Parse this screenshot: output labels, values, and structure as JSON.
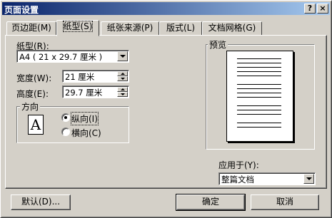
{
  "window": {
    "title": "页面设置",
    "help_label": "?",
    "close_label": "×"
  },
  "tabs": [
    {
      "label": "页边距(M)"
    },
    {
      "label": "纸型(S)"
    },
    {
      "label": "纸张来源(P)"
    },
    {
      "label": "版式(L)"
    },
    {
      "label": "文档网格(G)"
    }
  ],
  "paper": {
    "size_label": "纸型(R):",
    "size_value": "A4 ( 21 x 29.7 厘米 )",
    "width_label": "宽度(W):",
    "width_value": "21 厘米",
    "height_label": "高度(E):",
    "height_value": "29.7 厘米"
  },
  "orientation": {
    "group_label": "方向",
    "icon_glyph": "A",
    "portrait_label": "纵向(I)",
    "landscape_label": "横向(C)",
    "selected": "portrait"
  },
  "preview": {
    "group_label": "预览",
    "apply_label": "应用于(Y):",
    "apply_value": "整篇文档"
  },
  "buttons": {
    "default_label": "默认(D)...",
    "ok_label": "确定",
    "cancel_label": "取消"
  },
  "colors": {
    "titlebar_start": "#0a246a",
    "titlebar_end": "#a6caf0",
    "face": "#d4d0c8"
  }
}
